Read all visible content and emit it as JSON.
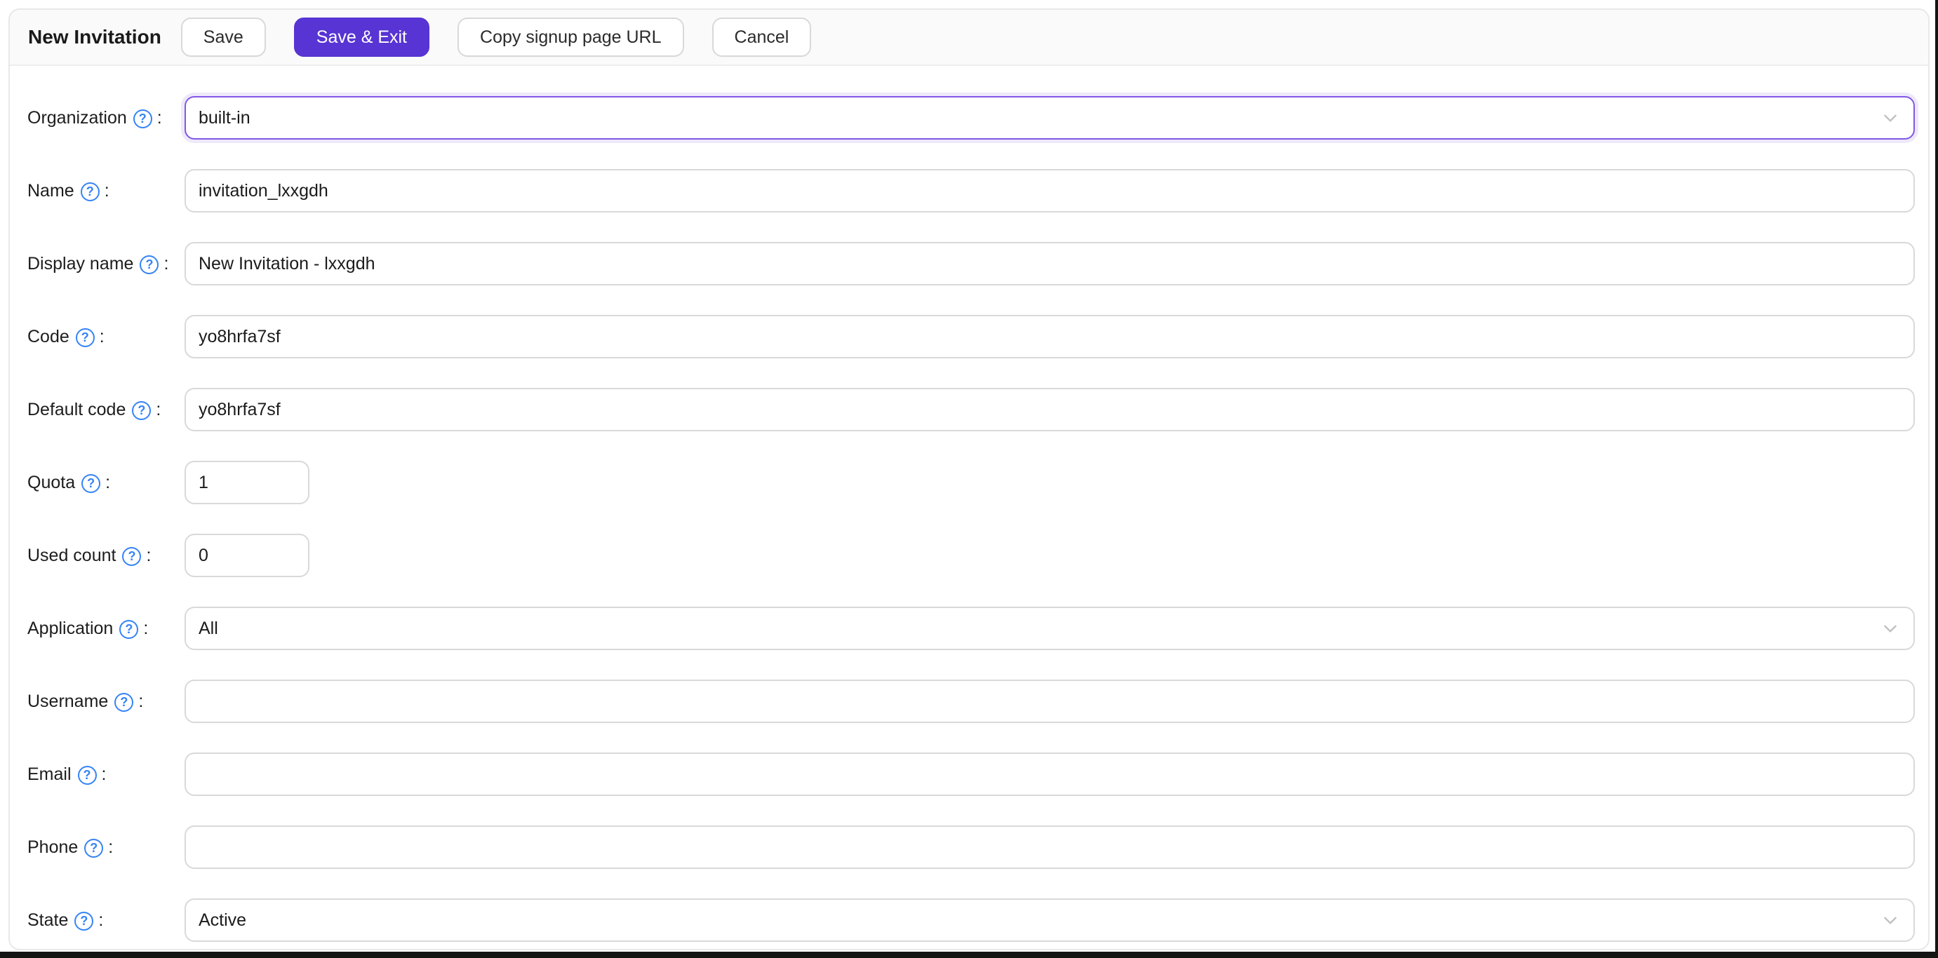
{
  "window": {
    "title": "New Invitation"
  },
  "toolbar": {
    "save": "Save",
    "save_exit": "Save & Exit",
    "copy_signup_url": "Copy signup page URL",
    "cancel": "Cancel"
  },
  "ui": {
    "colon": ":",
    "help_glyph": "?"
  },
  "colors": {
    "accent_purple": "#5734d3",
    "focus_border_purple": "#8257e5",
    "help_icon_blue": "#3583f6",
    "chevron_gray": "#c0c0c0",
    "input_border_gray": "#d9d9d9",
    "header_bg": "#fafafa"
  },
  "fields": [
    {
      "label": "Organization",
      "type": "select",
      "value": "built-in",
      "state": "focused"
    },
    {
      "label": "Name",
      "type": "text",
      "value": "invitation_lxxgdh"
    },
    {
      "label": "Display name",
      "type": "text",
      "value": "New Invitation - lxxgdh"
    },
    {
      "label": "Code",
      "type": "text",
      "value": "yo8hrfa7sf"
    },
    {
      "label": "Default code",
      "type": "text",
      "value": "yo8hrfa7sf"
    },
    {
      "label": "Quota",
      "type": "text-small",
      "value": "1"
    },
    {
      "label": "Used count",
      "type": "text-small",
      "value": "0"
    },
    {
      "label": "Application",
      "type": "select",
      "value": "All"
    },
    {
      "label": "Username",
      "type": "text",
      "value": ""
    },
    {
      "label": "Email",
      "type": "text",
      "value": ""
    },
    {
      "label": "Phone",
      "type": "text",
      "value": ""
    },
    {
      "label": "State",
      "type": "select",
      "value": "Active"
    }
  ]
}
